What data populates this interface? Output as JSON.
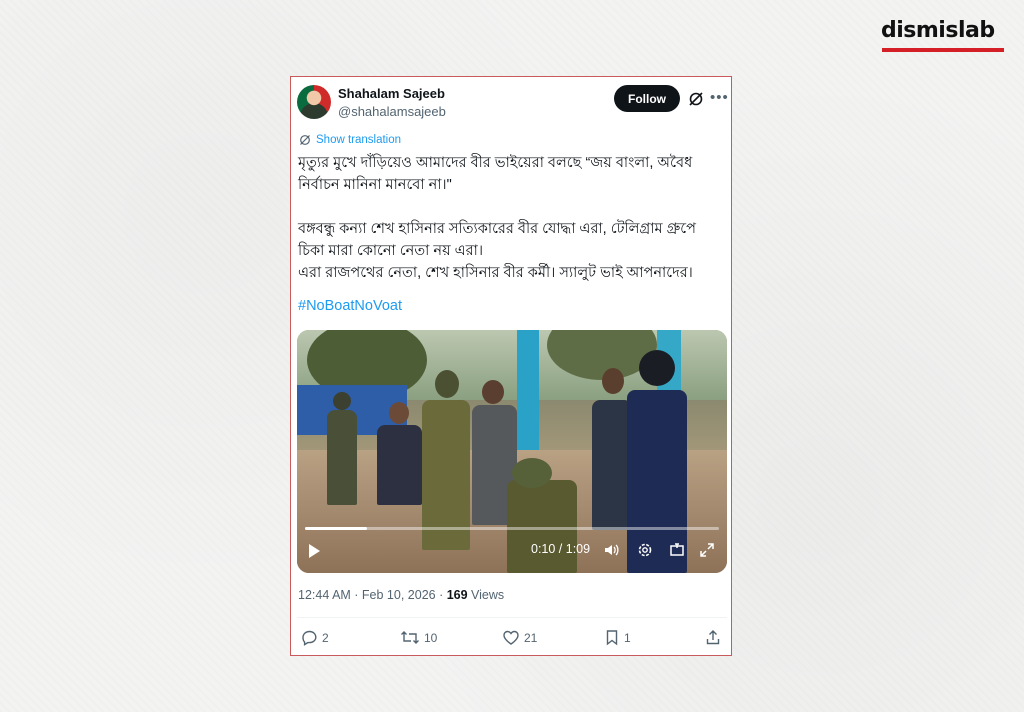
{
  "brand": {
    "logo_text": "dismislab",
    "accent": "#d41f26"
  },
  "tweet": {
    "author_name": "Shahalam Sajeeb",
    "author_handle": "@shahalamsajeeb",
    "follow_label": "Follow",
    "show_translation_label": "Show translation",
    "text_lines": [
      "মৃত্যুর মুখে দাঁড়িয়েও আমাদের বীর ভাইয়েরা বলছে “জয় বাংলা, অবৈধ",
      "নির্বাচন মানিনা মানবো না।\"",
      "বঙ্গবন্ধু কন্যা শেখ হাসিনার সত্যিকারের বীর যোদ্ধা এরা, টেলিগ্রাম গ্রুপে",
      "চিকা মারা কোনো নেতা নয় এরা।",
      "এরা রাজপথের নেতা, শেখ হাসিনার বীর কর্মী। স্যালুট ভাই আপনাদের।"
    ],
    "hashtag": "#NoBoatNoVoat",
    "video": {
      "time_display": "0:10 / 1:09",
      "progress": 0.15
    },
    "timestamp": "12:44 AM · Feb 10, 2026 · ",
    "views_count": "169",
    "views_label": " Views",
    "replies": "2",
    "reposts": "10",
    "likes": "21",
    "bookmarks": "1",
    "link_color": "#1d9bf0"
  }
}
